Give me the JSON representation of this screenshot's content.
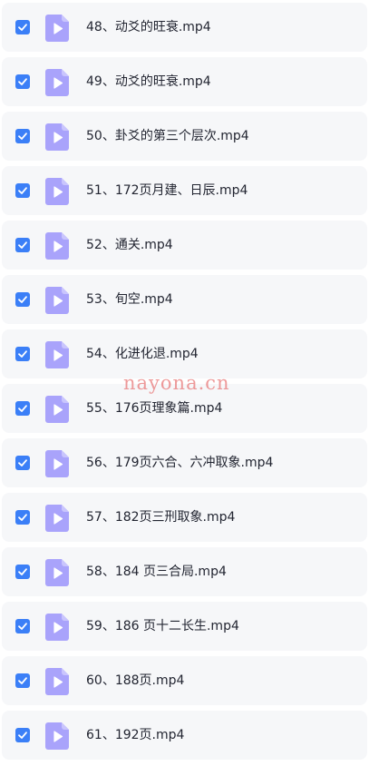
{
  "colors": {
    "row_background": "#f6f7f9",
    "checkbox_checked": "#3b7ff7",
    "video_icon": "#a9a3fb",
    "text": "#222531",
    "watermark": "#e87878"
  },
  "files": [
    {
      "name": "48、动爻的旺衰.mp4",
      "checked": true,
      "icon": "video-file-icon"
    },
    {
      "name": "49、动爻的旺衰.mp4",
      "checked": true,
      "icon": "video-file-icon"
    },
    {
      "name": "50、卦爻的第三个层次.mp4",
      "checked": true,
      "icon": "video-file-icon"
    },
    {
      "name": "51、172页月建、日辰.mp4",
      "checked": true,
      "icon": "video-file-icon"
    },
    {
      "name": "52、通关.mp4",
      "checked": true,
      "icon": "video-file-icon"
    },
    {
      "name": "53、旬空.mp4",
      "checked": true,
      "icon": "video-file-icon"
    },
    {
      "name": "54、化进化退.mp4",
      "checked": true,
      "icon": "video-file-icon"
    },
    {
      "name": "55、176页理象篇.mp4",
      "checked": true,
      "icon": "video-file-icon"
    },
    {
      "name": "56、179页六合、六冲取象.mp4",
      "checked": true,
      "icon": "video-file-icon"
    },
    {
      "name": "57、182页三刑取象.mp4",
      "checked": true,
      "icon": "video-file-icon"
    },
    {
      "name": "58、184 页三合局.mp4",
      "checked": true,
      "icon": "video-file-icon"
    },
    {
      "name": "59、186 页十二长生.mp4",
      "checked": true,
      "icon": "video-file-icon"
    },
    {
      "name": "60、188页.mp4",
      "checked": true,
      "icon": "video-file-icon"
    },
    {
      "name": "61、192页.mp4",
      "checked": true,
      "icon": "video-file-icon"
    }
  ],
  "watermark": {
    "text": "nayona.cn"
  }
}
